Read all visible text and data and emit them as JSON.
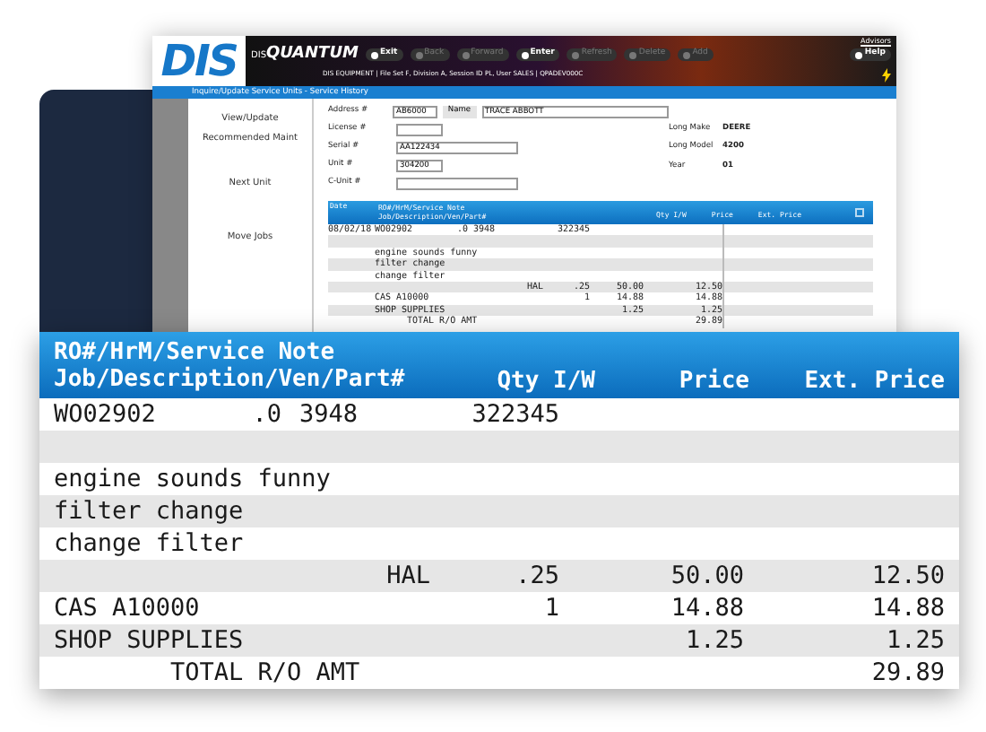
{
  "app_window": {
    "logo": "DIS",
    "brand_prefix": "DIS",
    "brand": "QUANTUM",
    "user": "Advisors",
    "toolbar": [
      {
        "label": "Exit",
        "disabled": false
      },
      {
        "label": "Back",
        "disabled": true
      },
      {
        "label": "Forward",
        "disabled": true
      },
      {
        "label": "Enter",
        "disabled": false
      },
      {
        "label": "Refresh",
        "disabled": true
      },
      {
        "label": "Delete",
        "disabled": true
      },
      {
        "label": "Add",
        "disabled": true
      }
    ],
    "help": "Help",
    "session": "DIS EQUIPMENT | File Set F, Division A, Session ID PL, User SALES | QPADEV000C",
    "breadcrumb": "Inquire/Update Service Units - Service History",
    "sidebar": [
      "View/Update",
      "Recommended Maint",
      "Next Unit",
      "Move Jobs"
    ],
    "name_button": "Name",
    "fields": [
      {
        "label": "Address #",
        "value": "AB6000",
        "name": "TRACE ABBOTT"
      },
      {
        "label": "License #"
      },
      {
        "label": "Serial #",
        "value": "AA122434"
      },
      {
        "label": "Unit #",
        "value": "304200"
      },
      {
        "label": "C-Unit #"
      }
    ],
    "info": [
      {
        "label": "Long Make",
        "value": "DEERE"
      },
      {
        "label": "Long Model",
        "value": "4200"
      },
      {
        "label": "Year",
        "value": "01"
      }
    ],
    "history": {
      "columns": [
        "Date",
        "RO#/HrM/Service Note",
        "Job/Description/Ven/Part#",
        "Qty I/W",
        "Price",
        "Ext. Price"
      ],
      "rows": [
        {
          "kind": "line",
          "date": "08/02/18",
          "note": "WO02902",
          "code": ".0",
          "part": "3948",
          "unit": "",
          "qty": "322345",
          "price": "",
          "ext": ""
        },
        {
          "kind": "blank"
        },
        {
          "kind": "note",
          "note": "engine sounds funny"
        },
        {
          "kind": "note",
          "note": "filter change"
        },
        {
          "kind": "note",
          "note": "change filter"
        },
        {
          "kind": "line",
          "note": "",
          "code": "",
          "part": "",
          "unit": "HAL",
          "qty": ".25",
          "price": "50.00",
          "ext": "12.50"
        },
        {
          "kind": "line",
          "note": "CAS A10000",
          "code": "",
          "part": "",
          "unit": "",
          "qty": "1",
          "price": "14.88",
          "ext": "14.88"
        },
        {
          "kind": "line",
          "note": "SHOP SUPPLIES",
          "code": "",
          "part": "",
          "unit": "",
          "qty": "",
          "price": "1.25",
          "ext": "1.25"
        },
        {
          "kind": "total",
          "note": "TOTAL R/O AMT",
          "ext": "29.89"
        }
      ]
    }
  },
  "detail_view": {
    "columns": [
      "RO#/HrM/Service Note",
      "Job/Description/Ven/Part#",
      "Qty I/W",
      "Price",
      "Ext. Price"
    ],
    "rows": [
      {
        "kind": "line",
        "note": "WO02902",
        "code": ".0",
        "part": "3948",
        "unit": "",
        "qty": "322345",
        "price": "",
        "ext": ""
      },
      {
        "kind": "blank"
      },
      {
        "kind": "note",
        "note": "engine sounds funny"
      },
      {
        "kind": "note",
        "note": "filter change"
      },
      {
        "kind": "note",
        "note": "change filter"
      },
      {
        "kind": "line",
        "note": "",
        "code": "",
        "part": "",
        "unit": "HAL",
        "qty": ".25",
        "price": "50.00",
        "ext": "12.50"
      },
      {
        "kind": "line",
        "note": "CAS A10000",
        "code": "",
        "part": "",
        "unit": "",
        "qty": "1",
        "price": "14.88",
        "ext": "14.88"
      },
      {
        "kind": "line",
        "note": "SHOP SUPPLIES",
        "code": "",
        "part": "",
        "unit": "",
        "qty": "",
        "price": "1.25",
        "ext": "1.25"
      },
      {
        "kind": "total",
        "note": "TOTAL R/O AMT",
        "ext": "29.89"
      }
    ]
  }
}
